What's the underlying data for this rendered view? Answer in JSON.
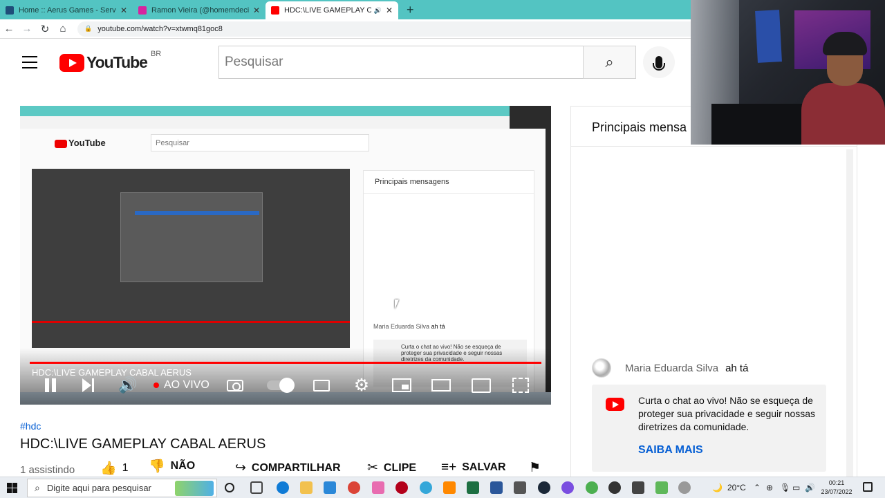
{
  "browser": {
    "tabs": [
      {
        "title": "Home :: Aerus Games - Servidor",
        "color": "#1f4e79"
      },
      {
        "title": "Ramon Vieira (@homemdecienci",
        "color": "#d6249f"
      },
      {
        "title": "HDC:\\LIVE GAMEPLAY CABAL",
        "color": "#ff0000",
        "active": true
      }
    ],
    "url": "youtube.com/watch?v=xtwmq81goc8"
  },
  "masthead": {
    "logo_text": "YouTube",
    "country": "BR",
    "search_placeholder": "Pesquisar"
  },
  "player": {
    "inner_search": "Pesquisar",
    "inner_logo": "YouTube",
    "inner_chat_header": "Principais mensagens",
    "inner_chat_author": "Maria Eduarda Silva",
    "inner_chat_text": "ah tá",
    "inner_notice": "Curta o chat ao vivo! Não se esqueça de proteger sua privacidade e seguir nossas diretrizes da comunidade.",
    "overlay_title": "HDC:\\LIVE GAMEPLAY CABAL AERUS",
    "live_label": "AO VIVO"
  },
  "video": {
    "hashtag": "#hdc",
    "title": "HDC:\\LIVE GAMEPLAY CABAL AERUS",
    "watching": "1 assistindo",
    "likes": "1",
    "dislike_label": "NÃO",
    "share_label": "COMPARTILHAR",
    "clip_label": "CLIPE",
    "save_label": "SALVAR"
  },
  "chat": {
    "header": "Principais mensa",
    "author": "Maria Eduarda Silva",
    "message": "ah tá",
    "notice": "Curta o chat ao vivo! Não se esqueça de proteger sua privacidade e seguir nossas diretrizes da comunidade.",
    "notice_link": "SAIBA MAIS"
  },
  "taskbar": {
    "search_placeholder": "Digite aqui para pesquisar",
    "temperature": "20°C",
    "time": "00:21",
    "date": "23/07/2022"
  }
}
